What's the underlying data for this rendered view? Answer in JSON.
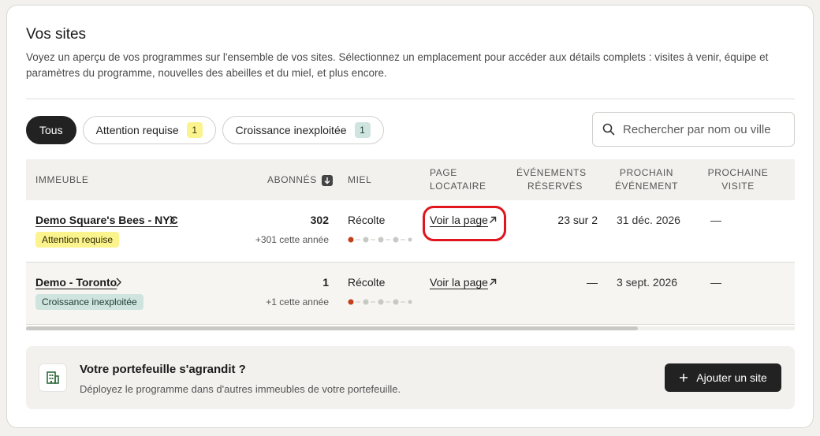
{
  "section": {
    "title": "Vos sites",
    "description": "Voyez un aperçu de vos programmes sur l'ensemble de vos sites. Sélectionnez un emplacement pour accéder aux détails complets : visites à venir, équipe et paramètres du programme, nouvelles des abeilles et du miel, et plus encore."
  },
  "filters": {
    "all_label": "Tous",
    "attention_label": "Attention requise",
    "attention_count": "1",
    "growth_label": "Croissance inexploitée",
    "growth_count": "1"
  },
  "search": {
    "placeholder": "Rechercher par nom ou ville"
  },
  "table": {
    "headers": {
      "building": "IMMEUBLE",
      "subscribers": "ABONNÉS",
      "honey": "MIEL",
      "tenant_page_1": "PAGE",
      "tenant_page_2": "LOCATAIRE",
      "reserved_1": "ÉVÉNEMENTS",
      "reserved_2": "RÉSERVÉS",
      "next_event_1": "PROCHAIN",
      "next_event_2": "ÉVÉNEMENT",
      "next_visit_1": "PROCHAINE",
      "next_visit_2": "VISITE"
    },
    "rows": [
      {
        "name": "Demo Square's Bees - NYC",
        "badge": "Attention requise",
        "subscribers": "302",
        "subscribers_delta": "+301 cette année",
        "honey_stage": "Récolte",
        "honey_progress_step": 1,
        "honey_progress_total": 5,
        "tenant_link": "Voir la page",
        "reserved": "23 sur 2",
        "next_event": "31 déc. 2026",
        "next_visit": "—"
      },
      {
        "name": "Demo - Toronto",
        "badge": "Croissance inexploitée",
        "subscribers": "1",
        "subscribers_delta": "+1 cette année",
        "honey_stage": "Récolte",
        "honey_progress_step": 1,
        "honey_progress_total": 5,
        "tenant_link": "Voir la page",
        "reserved": "—",
        "next_event": "3 sept. 2026",
        "next_visit": "—"
      }
    ]
  },
  "banner": {
    "title": "Votre portefeuille s'agrandit ?",
    "description": "Déployez le programme dans d'autres immeubles de votre portefeuille.",
    "button_label": "Ajouter un site"
  },
  "colors": {
    "dark": "#222222",
    "attention_badge": "#fbf38e",
    "growth_badge": "#cfe4df",
    "progress_active": "#c2401c",
    "progress_inactive": "#c8c8c4",
    "highlight": "#e0151d",
    "icon_green": "#2f6b3c"
  }
}
